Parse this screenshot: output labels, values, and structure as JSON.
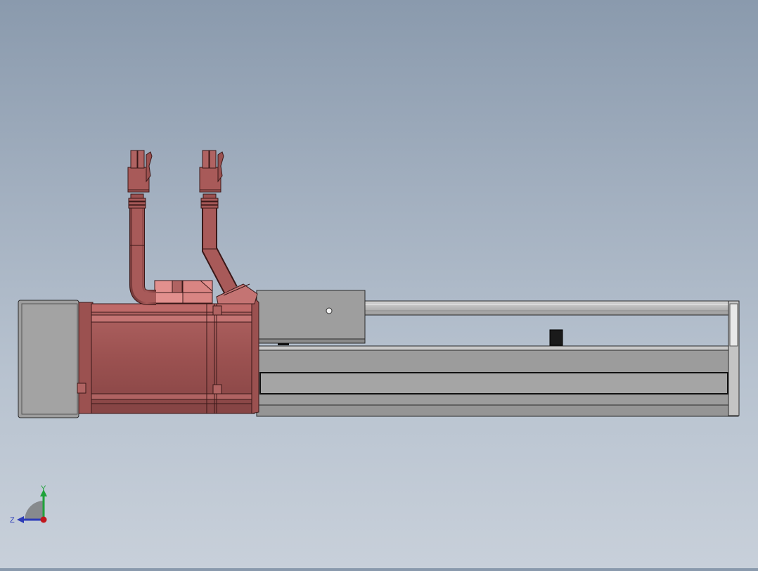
{
  "viewport": {
    "background_top": "#8a9aad",
    "background_bottom": "#c8d0da"
  },
  "model": {
    "motor_color": "#9b5150",
    "motor_highlight": "#c46e6d",
    "motor_dark": "#6b3333",
    "actuator_color": "#9a9a9a",
    "actuator_light": "#c8c8c8",
    "edge_color": "#2a2a2a"
  },
  "triad": {
    "y_label": "Y",
    "z_label": "Z",
    "y_color": "#1fa23a",
    "z_color": "#2c3bb8",
    "x_color": "#c0171d"
  }
}
